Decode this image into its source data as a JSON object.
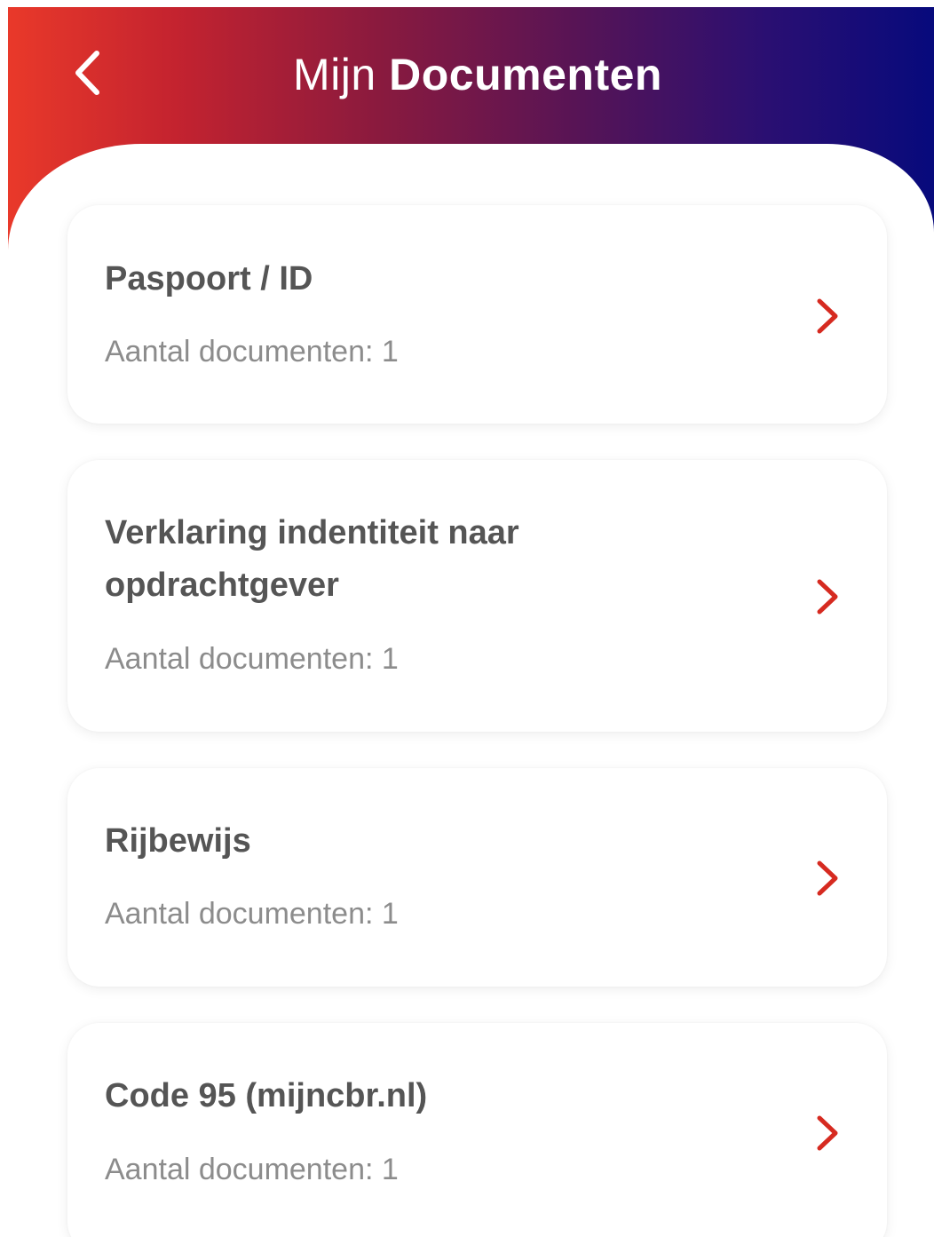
{
  "header": {
    "title_light": "Mijn",
    "title_bold": "Documenten",
    "back_icon": "chevron-left-icon"
  },
  "colors": {
    "gradient_start": "#e9392a",
    "gradient_end": "#070a7c",
    "accent_chevron": "#d62a20",
    "title_text": "#555555",
    "subtitle_text": "#8c8c8c"
  },
  "documents": [
    {
      "title": "Paspoort / ID",
      "count_label": "Aantal documenten: 1",
      "icon": "chevron-right-icon"
    },
    {
      "title": "Verklaring indentiteit naar opdrachtgever",
      "count_label": "Aantal documenten: 1",
      "icon": "chevron-right-icon"
    },
    {
      "title": "Rijbewijs",
      "count_label": "Aantal documenten: 1",
      "icon": "chevron-right-icon"
    },
    {
      "title": "Code 95 (mijncbr.nl)",
      "count_label": "Aantal documenten: 1",
      "icon": "chevron-right-icon"
    }
  ]
}
